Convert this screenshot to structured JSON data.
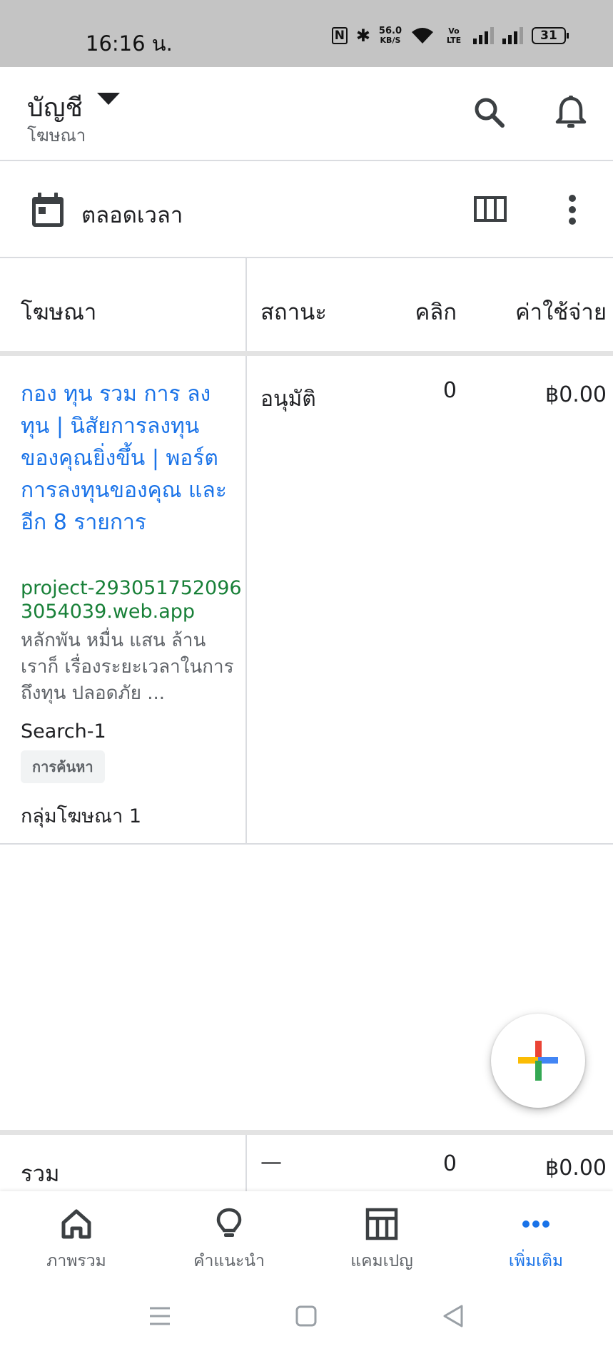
{
  "status_bar": {
    "time": "16:16 น.",
    "net_speed_value": "56.0",
    "net_speed_unit": "KB/S",
    "volte": "Vo LTE",
    "battery": "31"
  },
  "header": {
    "title": "บัญชี",
    "subtitle": "โฆษณา"
  },
  "toolbar": {
    "date_range": "ตลอดเวลา"
  },
  "table": {
    "headers": {
      "ad": "โฆษณา",
      "status": "สถานะ",
      "clicks": "คลิก",
      "cost": "ค่าใช้จ่าย"
    },
    "row": {
      "title": "กอง ทุน รวม การ ลง ทุน | นิสัยการลงทุนของคุณยิ่งขึ้น | พอร์ตการลงทุนของคุณ และอีก 8 รายการ",
      "url": "project-2930517520963054039.web.app",
      "description": "หลักพัน หมื่น แสน ล้าน เราก็ เรื่องระยะเวลาในการถึงทุน ปลอดภัย ...",
      "campaign": "Search-1",
      "chip": "การค้นหา",
      "ad_group": "กลุ่มโฆษณา 1",
      "status": "อนุมัติ",
      "clicks": "0",
      "cost": "฿0.00"
    },
    "total": {
      "label": "รวม",
      "status": "—",
      "clicks": "0",
      "cost": "฿0.00"
    }
  },
  "bottom_nav": {
    "items": [
      {
        "label": "ภาพรวม",
        "icon": "home-icon"
      },
      {
        "label": "คำแนะนำ",
        "icon": "lightbulb-icon"
      },
      {
        "label": "แคมเปญ",
        "icon": "campaign-table-icon"
      },
      {
        "label": "เพิ่มเติม",
        "icon": "more-horiz-icon",
        "active": true
      }
    ]
  },
  "colors": {
    "link_blue": "#1a73e8",
    "url_green": "#188038",
    "google_red": "#ea4335",
    "google_yellow": "#fbbc04",
    "google_blue": "#4285f4",
    "google_green": "#34a853"
  }
}
